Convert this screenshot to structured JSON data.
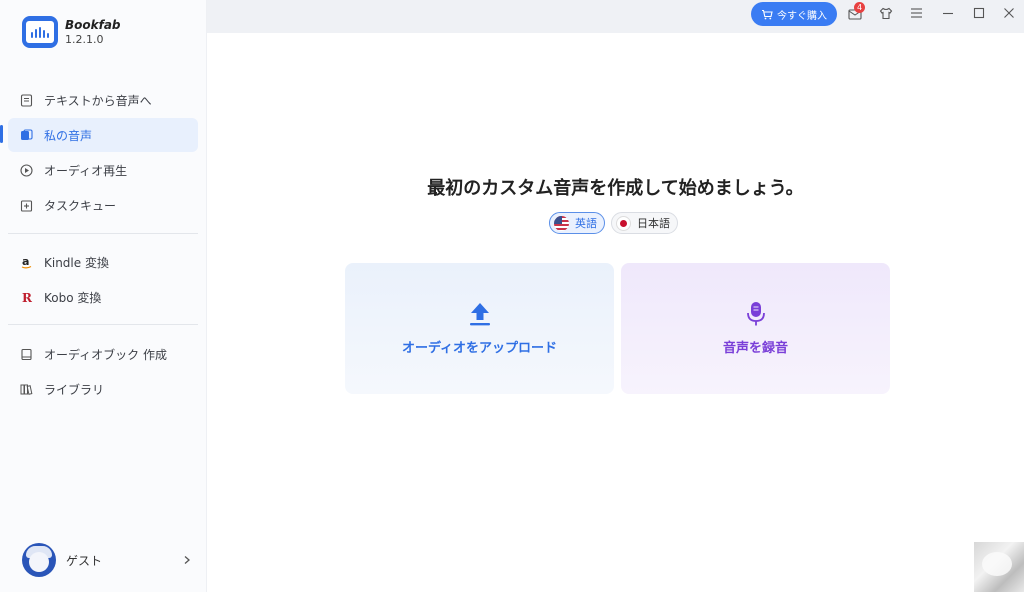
{
  "app": {
    "name": "Bookfab",
    "version": "1.2.1.0"
  },
  "sidebar": {
    "items": [
      {
        "label": "テキストから音声へ",
        "icon": "document-icon"
      },
      {
        "label": "私の音声",
        "icon": "voice-library-icon",
        "active": true
      },
      {
        "label": "オーディオ再生",
        "icon": "play-circle-icon"
      },
      {
        "label": "タスクキュー",
        "icon": "task-queue-icon"
      },
      {
        "label": "Kindle 変換",
        "icon": "kindle-icon"
      },
      {
        "label": "Kobo 変換",
        "icon": "kobo-icon"
      },
      {
        "label": "オーディオブック 作成",
        "icon": "audiobook-icon"
      },
      {
        "label": "ライブラリ",
        "icon": "library-icon"
      }
    ],
    "user": {
      "name": "ゲスト"
    }
  },
  "topbar": {
    "buy_label": "今すぐ購入",
    "notification_count": "4"
  },
  "main": {
    "heading": "最初のカスタム音声を作成して始めましょう。",
    "languages": [
      {
        "label": "英語",
        "selected": true
      },
      {
        "label": "日本語",
        "selected": false
      }
    ],
    "upload_label": "オーディオをアップロード",
    "record_label": "音声を録音"
  },
  "colors": {
    "accent": "#2f6fe4",
    "record_accent": "#7a3fd8",
    "badge": "#e84141"
  }
}
